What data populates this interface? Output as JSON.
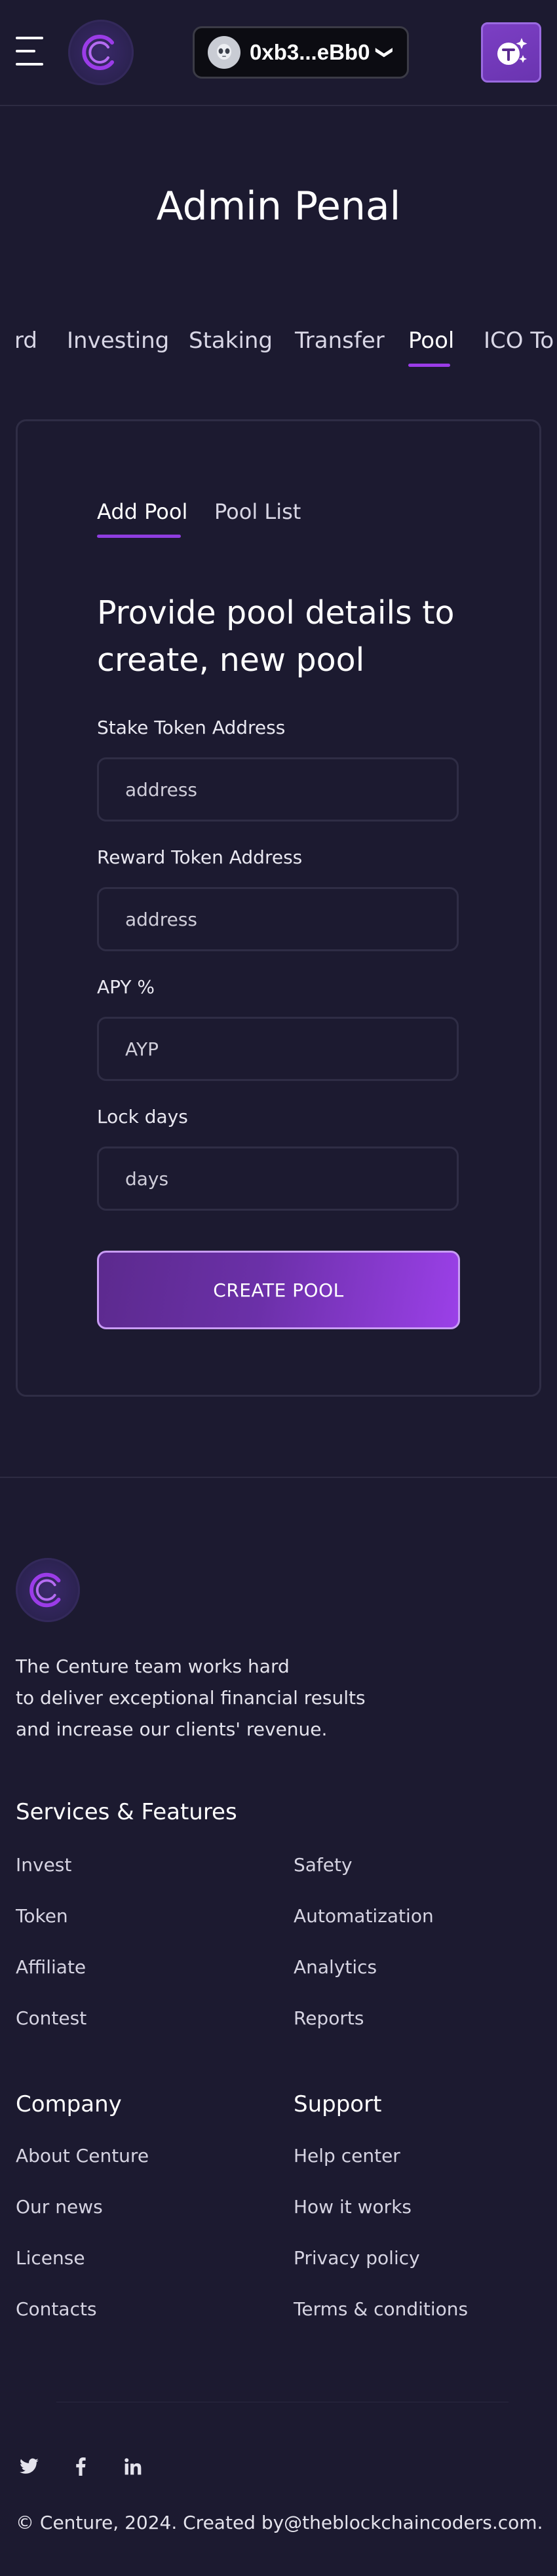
{
  "header": {
    "wallet_address": "0xb3...eBb0",
    "wallet_chevron": "❯",
    "icons": [
      "menu-icon",
      "centure-logo",
      "wallet-avatar-icon",
      "token-add-icon"
    ]
  },
  "page": {
    "title": "Admin Penal"
  },
  "nav_tabs": [
    {
      "label": "rd"
    },
    {
      "label": "Investing"
    },
    {
      "label": "Staking"
    },
    {
      "label": "Transfer"
    },
    {
      "label": "Pool",
      "active": true
    },
    {
      "label": "ICO To"
    }
  ],
  "card": {
    "tabs": [
      {
        "label": "Add Pool",
        "active": true
      },
      {
        "label": "Pool List"
      }
    ],
    "heading_line1": "Provide pool details to",
    "heading_line2": "create, new pool",
    "fields": [
      {
        "label": "Stake Token Address",
        "placeholder": "address"
      },
      {
        "label": "Reward Token Address",
        "placeholder": "address"
      },
      {
        "label": "APY %",
        "placeholder": "AYP"
      },
      {
        "label": "Lock days",
        "placeholder": "days"
      }
    ],
    "submit_label": "CREATE POOL"
  },
  "footer": {
    "description": [
      "The Centure team works hard",
      "to deliver exceptional financial results",
      "and increase our clients' revenue."
    ],
    "services_heading": "Services & Features",
    "services_col1": [
      "Invest",
      "Token",
      "Affiliate",
      "Contest"
    ],
    "services_col2": [
      "Safety",
      "Automatization",
      "Analytics",
      "Reports"
    ],
    "company_heading": "Company",
    "company_links": [
      "About Centure",
      "Our news",
      "License",
      "Contacts"
    ],
    "support_heading": "Support",
    "support_links": [
      "Help center",
      "How it works",
      "Privacy policy",
      "Terms & conditions"
    ],
    "social": [
      "twitter-icon",
      "facebook-icon",
      "linkedin-icon"
    ],
    "copyright": "© Centure, 2024. Created by@theblockchaincoders.com."
  },
  "colors": {
    "background": "#1c1a30",
    "accent": "#9b3ce8",
    "border": "#2f2d45"
  }
}
